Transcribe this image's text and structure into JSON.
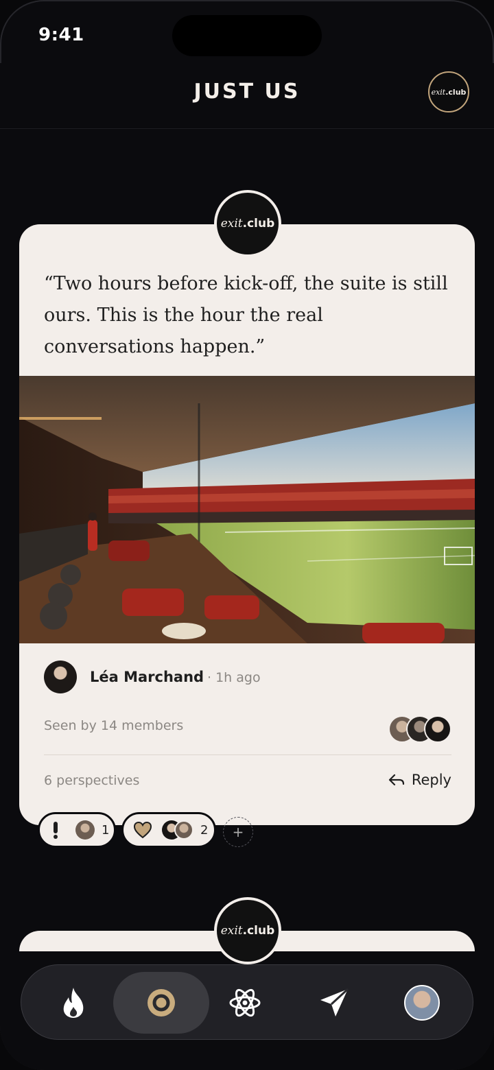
{
  "status_bar": {
    "time": "9:41"
  },
  "header": {
    "title": "JUST US",
    "logo_italic": "exit",
    "logo_bold": ".club"
  },
  "post": {
    "badge_italic": "exit",
    "badge_bold": ".club",
    "quote": "“Two hours before kick-off, the suite is still ours. This is the hour the real conversations happen.”",
    "author": "Léa Marchand",
    "time_ago": "· 1h ago",
    "seen_by": "Seen by 14 members",
    "perspectives": "6 perspectives",
    "reply_label": "Reply",
    "reactions": [
      {
        "icon": "exclamation-icon",
        "count": "1"
      },
      {
        "icon": "heart-icon",
        "count": "2"
      }
    ],
    "add_reaction": "+"
  },
  "next_post": {
    "badge_italic": "exit",
    "badge_bold": ".club"
  },
  "nav": {
    "items": [
      {
        "icon": "flame-icon"
      },
      {
        "icon": "circle-icon",
        "active": true
      },
      {
        "icon": "atom-icon"
      },
      {
        "icon": "send-icon"
      },
      {
        "icon": "profile-avatar"
      }
    ]
  },
  "colors": {
    "background": "#0b0b0e",
    "card": "#f3eeea",
    "accent_gold": "#c2a57c",
    "muted_text": "#8b8783"
  }
}
